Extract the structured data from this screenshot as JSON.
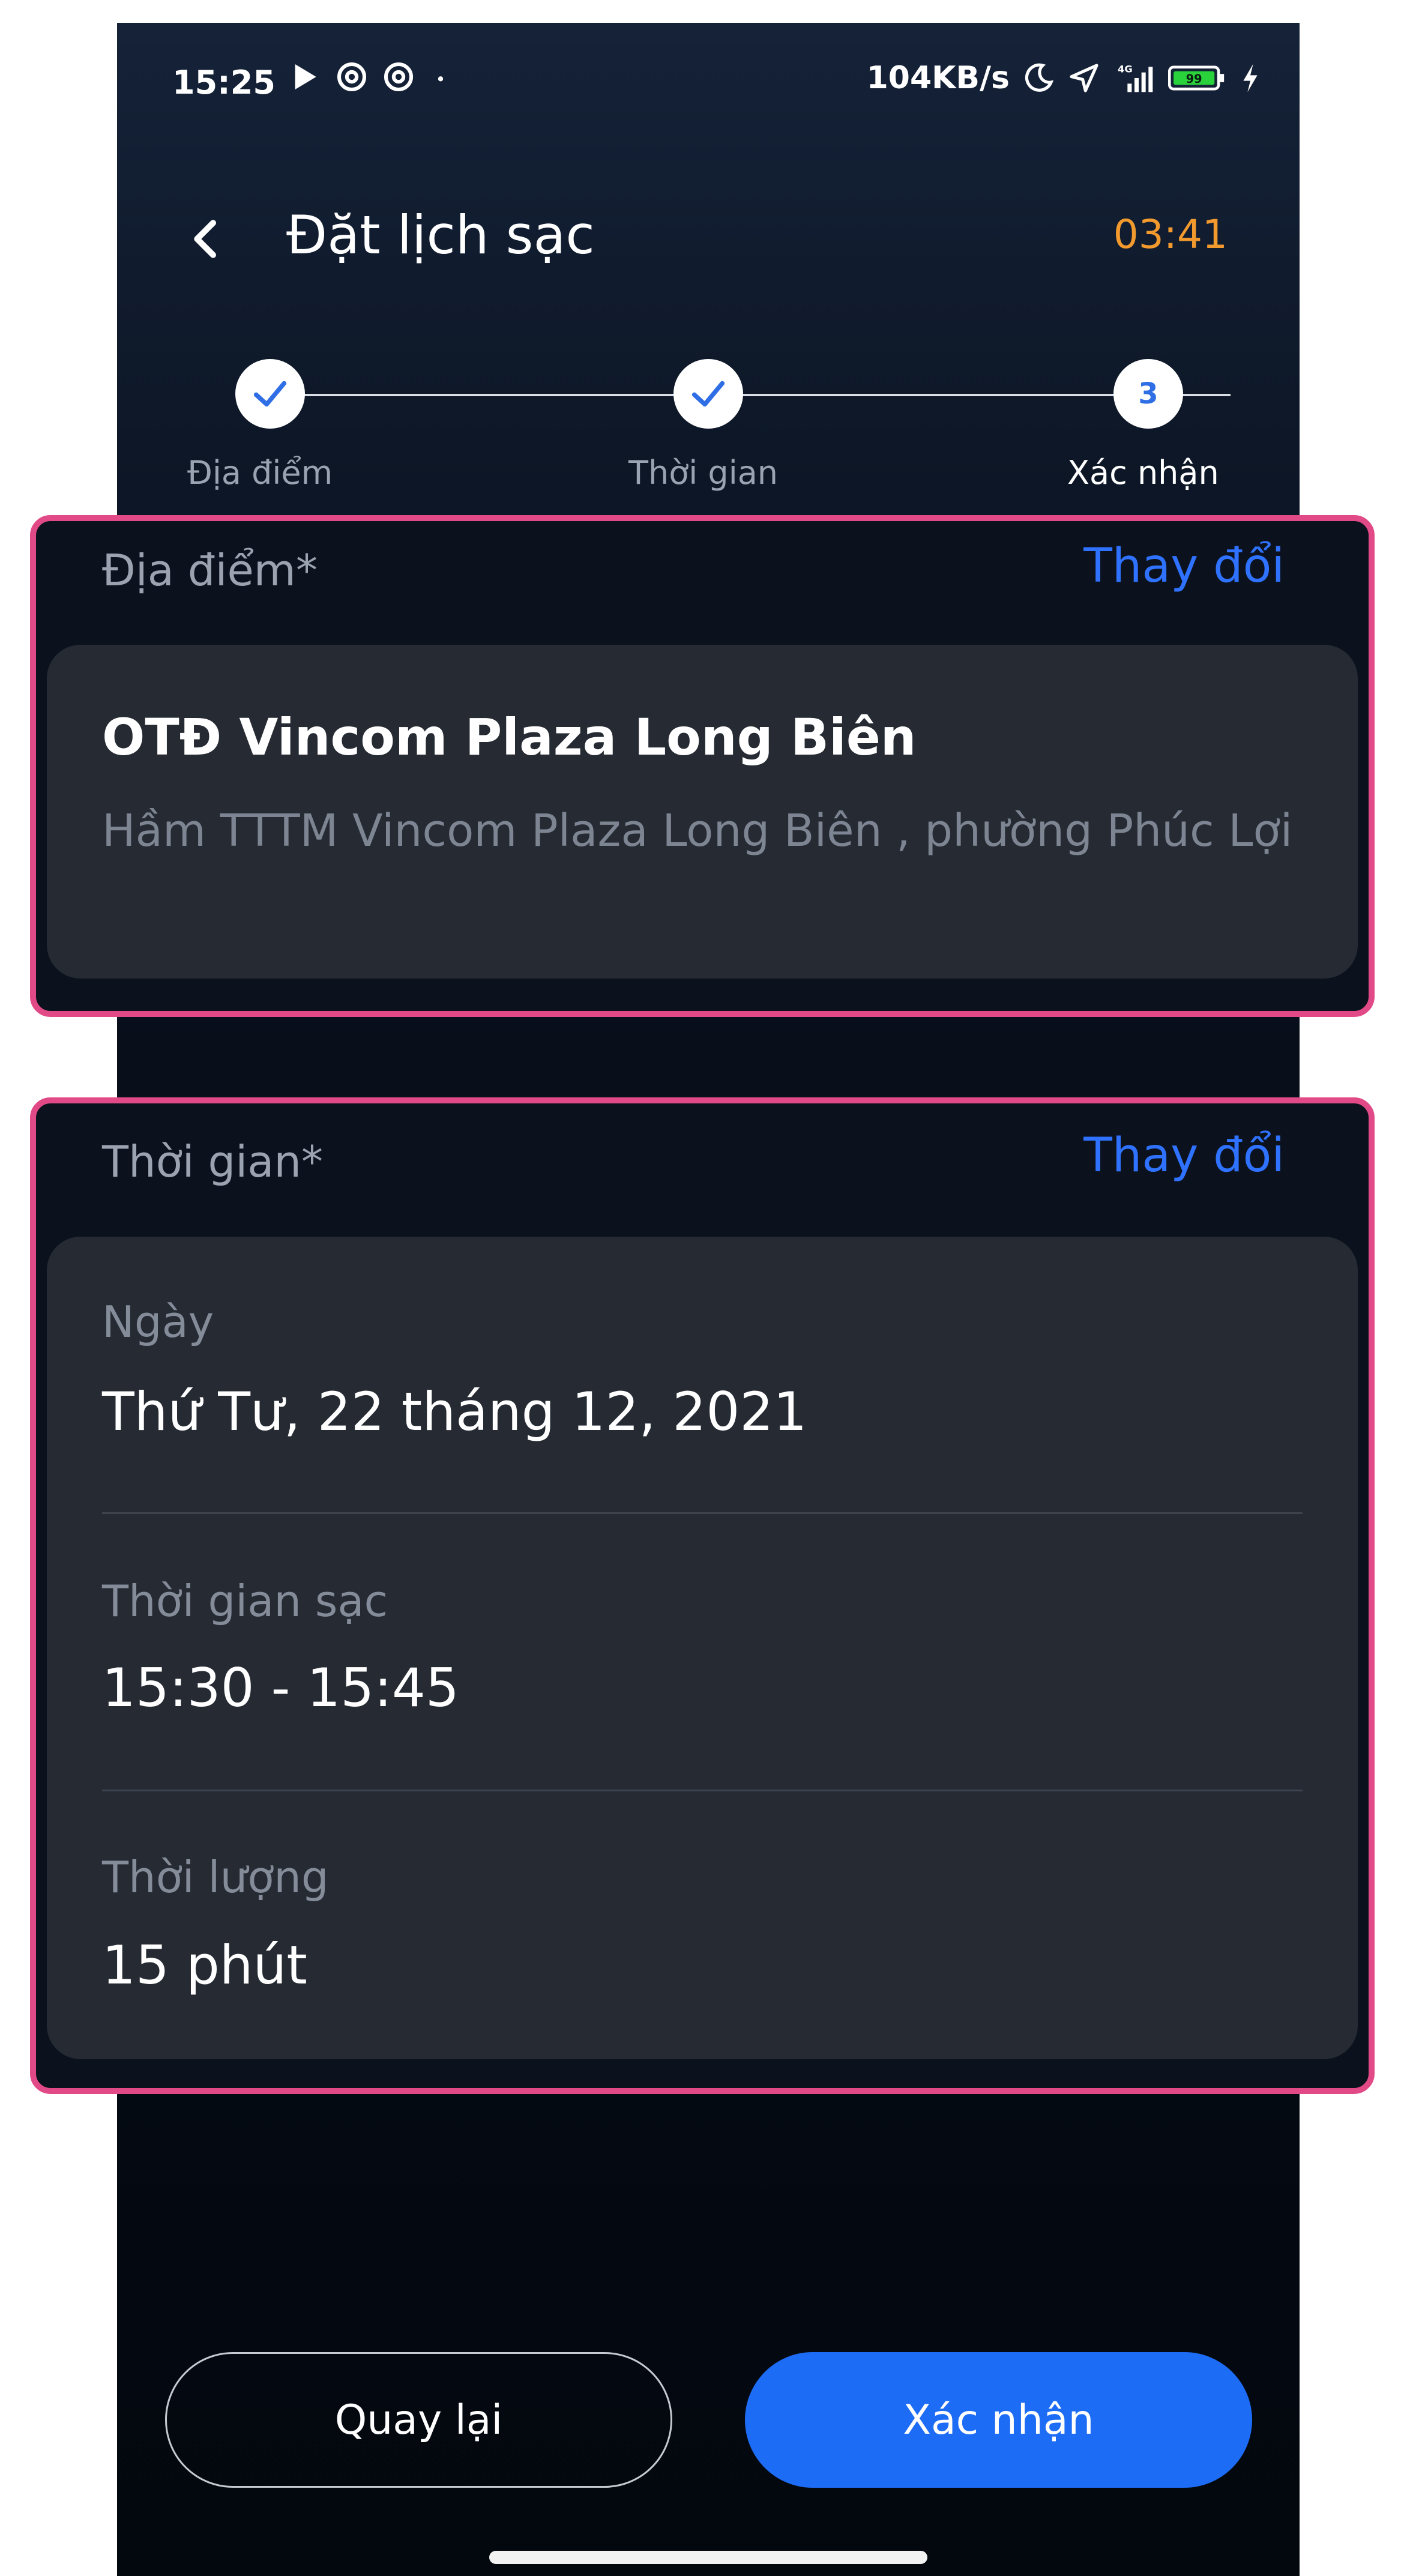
{
  "status_bar": {
    "time": "15:25",
    "network_speed": "104KB/s",
    "network_type": "4G",
    "battery": "99",
    "icons": [
      "play-icon",
      "at-icon",
      "at-icon",
      "dot-icon",
      "moon-icon",
      "location-icon",
      "signal-icon",
      "battery-icon",
      "charging-icon"
    ]
  },
  "header": {
    "back_icon": "chevron-left-icon",
    "title": "Đặt lịch sạc",
    "timer": "03:41",
    "timer_color": "#f29a2e"
  },
  "stepper": {
    "steps": [
      {
        "label": "Địa điểm",
        "state": "completed",
        "icon": "check-icon"
      },
      {
        "label": "Thời gian",
        "state": "completed",
        "icon": "check-icon"
      },
      {
        "label": "Xác nhận",
        "state": "current",
        "number": "3"
      }
    ]
  },
  "location_card": {
    "label": "Địa điểm*",
    "action": "Thay đổi",
    "name": "OTĐ Vincom Plaza Long Biên",
    "address": "Hầm TTTM Vincom Plaza Long Biên , phường Phúc Lợi"
  },
  "time_card": {
    "label": "Thời gian*",
    "action": "Thay đổi",
    "fields": [
      {
        "label": "Ngày",
        "value": "Thứ Tư, 22 tháng 12, 2021"
      },
      {
        "label": "Thời gian sạc",
        "value": "15:30 - 15:45"
      },
      {
        "label": "Thời lượng",
        "value": "15 phút"
      }
    ]
  },
  "footer": {
    "back_label": "Quay lại",
    "confirm_label": "Xác nhận",
    "accent_color": "#1d6cf5"
  },
  "highlight_color": "#e14a86"
}
